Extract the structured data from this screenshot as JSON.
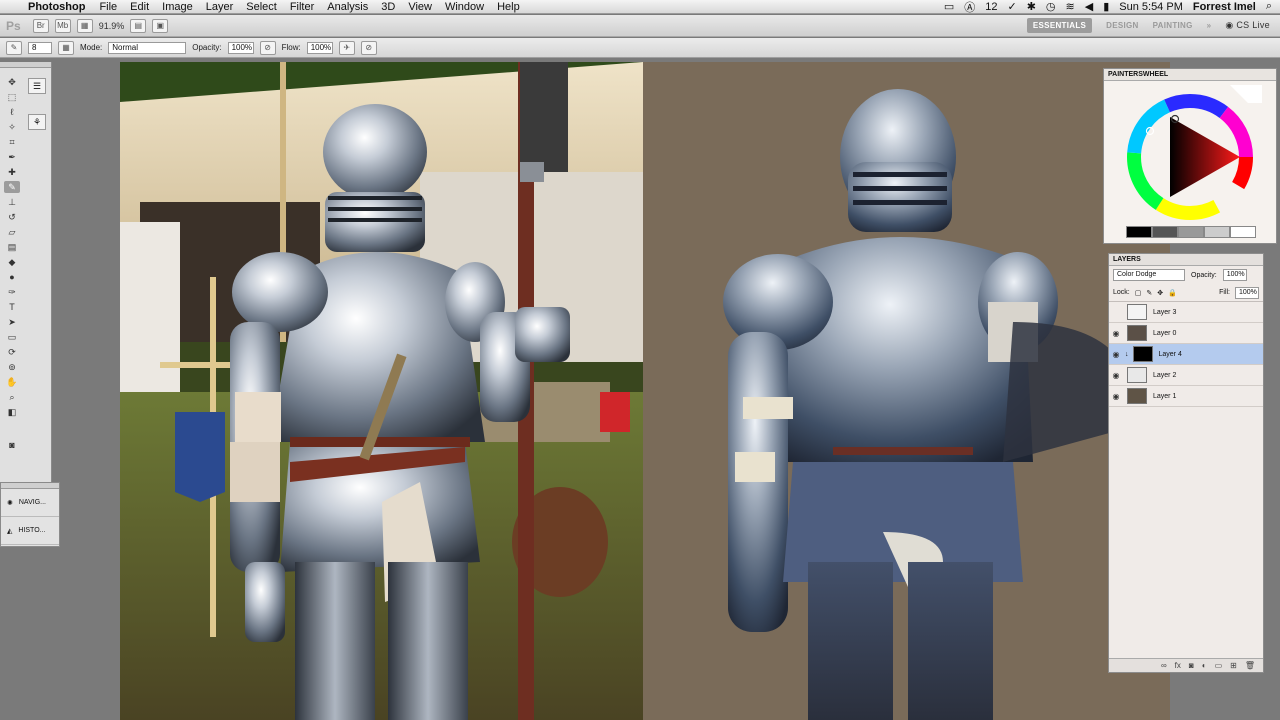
{
  "menubar": {
    "app": "Photoshop",
    "items": [
      "File",
      "Edit",
      "Image",
      "Layer",
      "Select",
      "Filter",
      "Analysis",
      "3D",
      "View",
      "Window",
      "Help"
    ],
    "status_num": "12",
    "clock": "Sun 5:54 PM",
    "user": "Forrest Imel"
  },
  "appbar": {
    "logo": "Ps",
    "zoom": "91.9%",
    "workspaces": [
      "ESSENTIALS",
      "DESIGN",
      "PAINTING"
    ],
    "more": "»",
    "cslive": "CS Live"
  },
  "options": {
    "brush_size": "8",
    "mode_label": "Mode:",
    "mode_value": "Normal",
    "opacity_label": "Opacity:",
    "opacity_value": "100%",
    "flow_label": "Flow:",
    "flow_value": "100%"
  },
  "mini_panel": {
    "items": [
      {
        "label": "NAVIG...",
        "icon": "navigator-icon"
      },
      {
        "label": "HISTO...",
        "icon": "history-icon"
      }
    ]
  },
  "wheel": {
    "title": "PAINTERSWHEEL"
  },
  "layers": {
    "title": "LAYERS",
    "blend_mode": "Color Dodge",
    "opacity_label": "Opacity:",
    "opacity_value": "100%",
    "lock_label": "Lock:",
    "fill_label": "Fill:",
    "fill_value": "100%",
    "rows": [
      {
        "name": "Layer 3",
        "visible": false,
        "selected": false,
        "thumb": "#f4f4f4"
      },
      {
        "name": "Layer 0",
        "visible": true,
        "selected": false,
        "thumb": "#5b5047"
      },
      {
        "name": "Layer 4",
        "visible": true,
        "selected": true,
        "thumb": "#000000"
      },
      {
        "name": "Layer 2",
        "visible": true,
        "selected": false,
        "thumb": "#e8e8e8"
      },
      {
        "name": "Layer 1",
        "visible": true,
        "selected": false,
        "thumb": "#5f5446"
      }
    ]
  }
}
